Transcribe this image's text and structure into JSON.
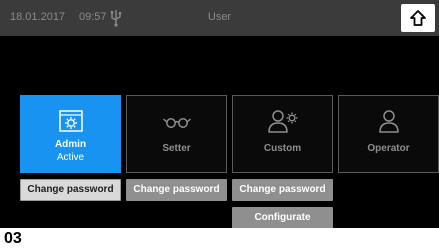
{
  "statusbar": {
    "date": "18.01.2017",
    "time": "09:57",
    "usb_icon": "usb-icon",
    "user_label": "User",
    "home_icon": "home-icon"
  },
  "roles": [
    {
      "name": "Admin",
      "status": "Active",
      "icon": "settings-window-icon",
      "active": true
    },
    {
      "name": "Setter",
      "icon": "glasses-icon",
      "active": false
    },
    {
      "name": "Custom",
      "icon": "user-gear-icon",
      "active": false
    },
    {
      "name": "Operator",
      "icon": "user-icon",
      "active": false
    }
  ],
  "buttons": {
    "change_password": "Change password",
    "configurate": "Configurate"
  },
  "colors": {
    "active_tile": "#1893f1",
    "statusbar": "#3b3b3b",
    "screen": "#000000"
  },
  "caption": "03"
}
